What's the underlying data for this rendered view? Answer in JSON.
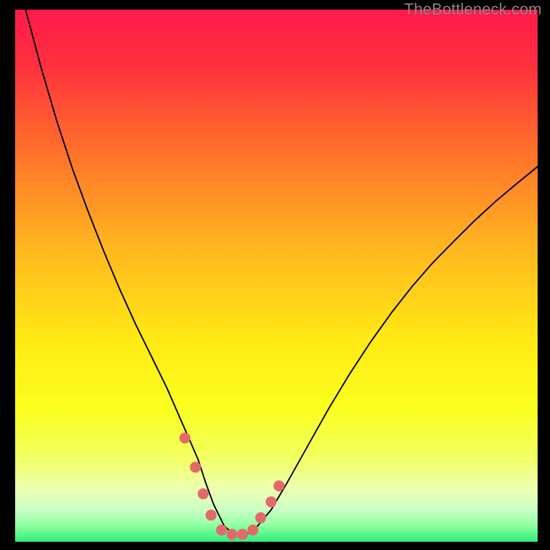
{
  "watermark": "TheBottleneck.com",
  "chart_data": {
    "type": "line",
    "title": "",
    "xlabel": "",
    "ylabel": "",
    "xlim": [
      0,
      100
    ],
    "ylim": [
      0,
      100
    ],
    "background_gradient": {
      "stops": [
        {
          "offset": 0.0,
          "color": "#ff1a4b"
        },
        {
          "offset": 0.1,
          "color": "#ff2f3f"
        },
        {
          "offset": 0.25,
          "color": "#ff6a2c"
        },
        {
          "offset": 0.45,
          "color": "#ffb71f"
        },
        {
          "offset": 0.62,
          "color": "#ffe915"
        },
        {
          "offset": 0.75,
          "color": "#fbff1e"
        },
        {
          "offset": 0.84,
          "color": "#f2ff60"
        },
        {
          "offset": 0.9,
          "color": "#ecffb0"
        },
        {
          "offset": 0.94,
          "color": "#ccffc6"
        },
        {
          "offset": 0.97,
          "color": "#8effa0"
        },
        {
          "offset": 1.0,
          "color": "#2dee7a"
        }
      ]
    },
    "series": [
      {
        "name": "bottleneck-curve",
        "stroke": "#000000",
        "stroke_width": 2,
        "x": [
          2,
          5,
          8,
          11,
          14,
          17,
          20,
          23,
          26,
          29,
          31,
          33,
          35,
          36.5,
          38,
          40,
          42,
          44,
          46,
          49,
          52,
          56,
          60,
          64,
          68,
          72,
          76,
          80,
          84,
          88,
          92,
          96,
          100
        ],
        "y": [
          100,
          89,
          79,
          70,
          62,
          54.5,
          47.5,
          41,
          35,
          29,
          24.5,
          20,
          15.5,
          11,
          7,
          3,
          1.2,
          1.2,
          2.5,
          6,
          11,
          18,
          25,
          31.5,
          37.5,
          43,
          48,
          52.5,
          56.5,
          60.4,
          64,
          67.3,
          70.5
        ]
      }
    ],
    "markers": {
      "name": "highlight-dots",
      "fill": "#e36a6a",
      "radius": 8,
      "x": [
        32.5,
        34.5,
        36,
        37.5,
        39.5,
        41.5,
        43.5,
        45.5,
        47,
        49,
        50.5
      ],
      "y": [
        19.5,
        14,
        9,
        5,
        2.2,
        1.4,
        1.4,
        2.2,
        4.5,
        7.5,
        10.5
      ]
    }
  }
}
